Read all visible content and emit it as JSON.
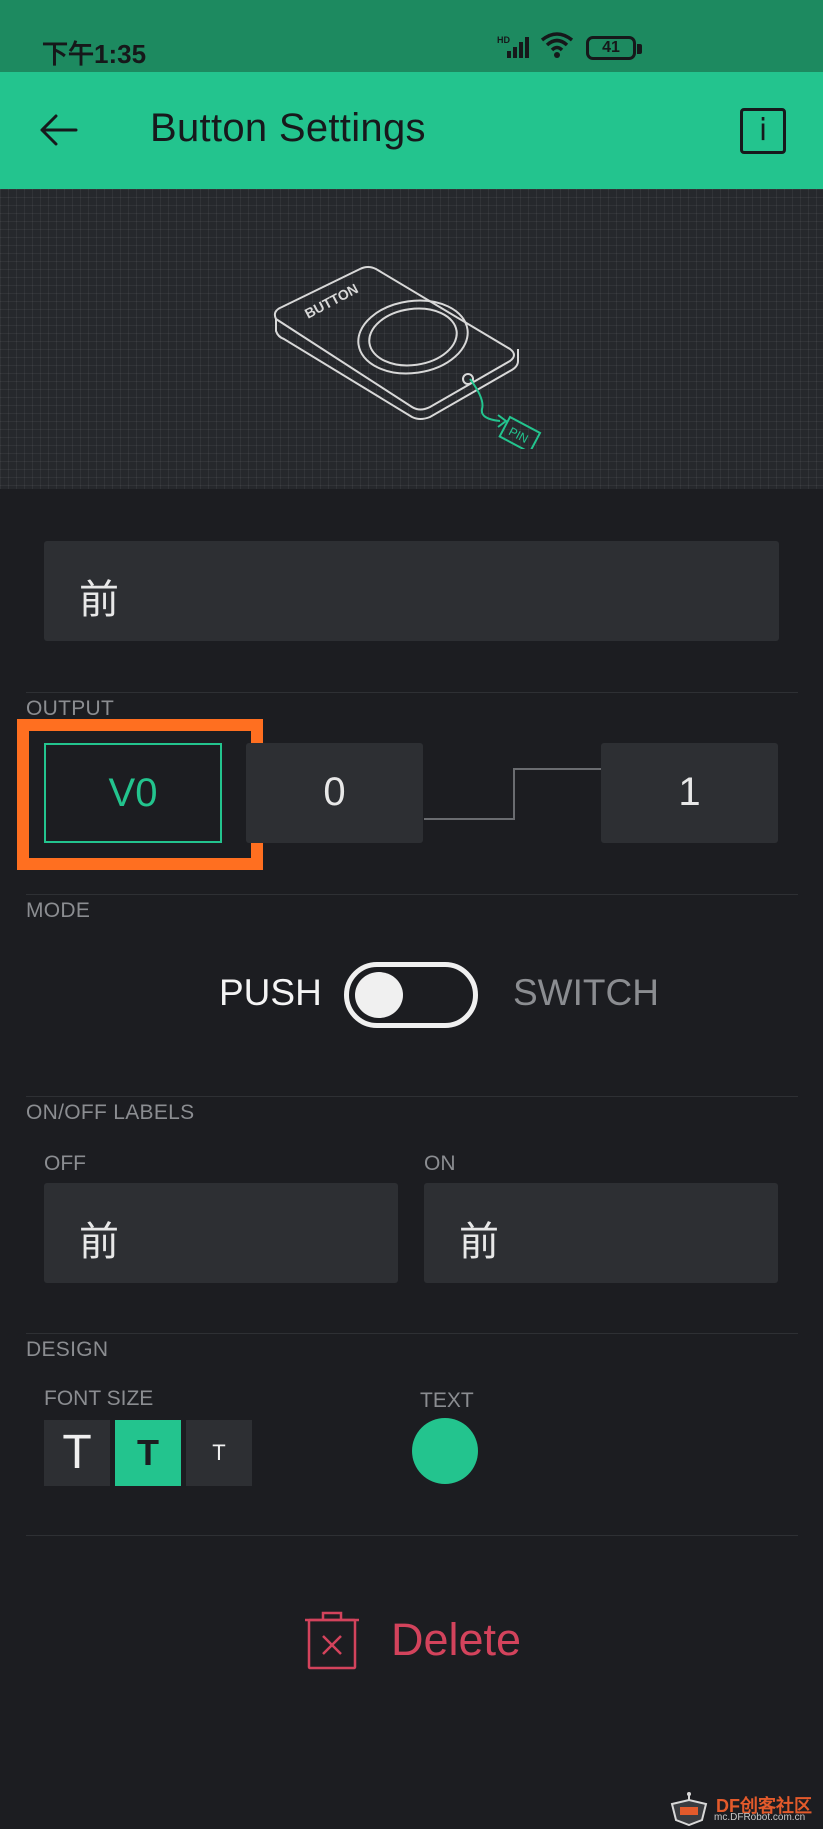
{
  "status_bar": {
    "time": "下午1:35",
    "signal_label": "HD",
    "battery": "41"
  },
  "app_bar": {
    "title": "Button Settings",
    "info_label": "i"
  },
  "widget_name": "前",
  "output": {
    "section_label": "OUTPUT",
    "pin": "V0",
    "low_value": "0",
    "high_value": "1"
  },
  "mode": {
    "section_label": "MODE",
    "push_label": "PUSH",
    "switch_label": "SWITCH",
    "is_switch": false
  },
  "labels": {
    "section_label": "ON/OFF LABELS",
    "off_caption": "OFF",
    "off_value": "前",
    "on_caption": "ON",
    "on_value": "前"
  },
  "design": {
    "section_label": "DESIGN",
    "font_size_label": "FONT SIZE",
    "font_sizes": [
      {
        "glyph": "T",
        "active": false
      },
      {
        "glyph": "T",
        "active": true
      },
      {
        "glyph": "T",
        "active": false
      }
    ],
    "text_color_label": "TEXT",
    "text_color": "#23c48e"
  },
  "illustration": {
    "button_text": "BUTTON",
    "pin_text": "PIN"
  },
  "delete_label": "Delete",
  "watermark": {
    "brand": "DF创客社区",
    "url": "mc.DFRobot.com.cn"
  },
  "colors": {
    "accent": "#23c48e",
    "status_bar": "#1d8a60",
    "danger": "#d3435c",
    "highlight": "#ff6f20"
  }
}
